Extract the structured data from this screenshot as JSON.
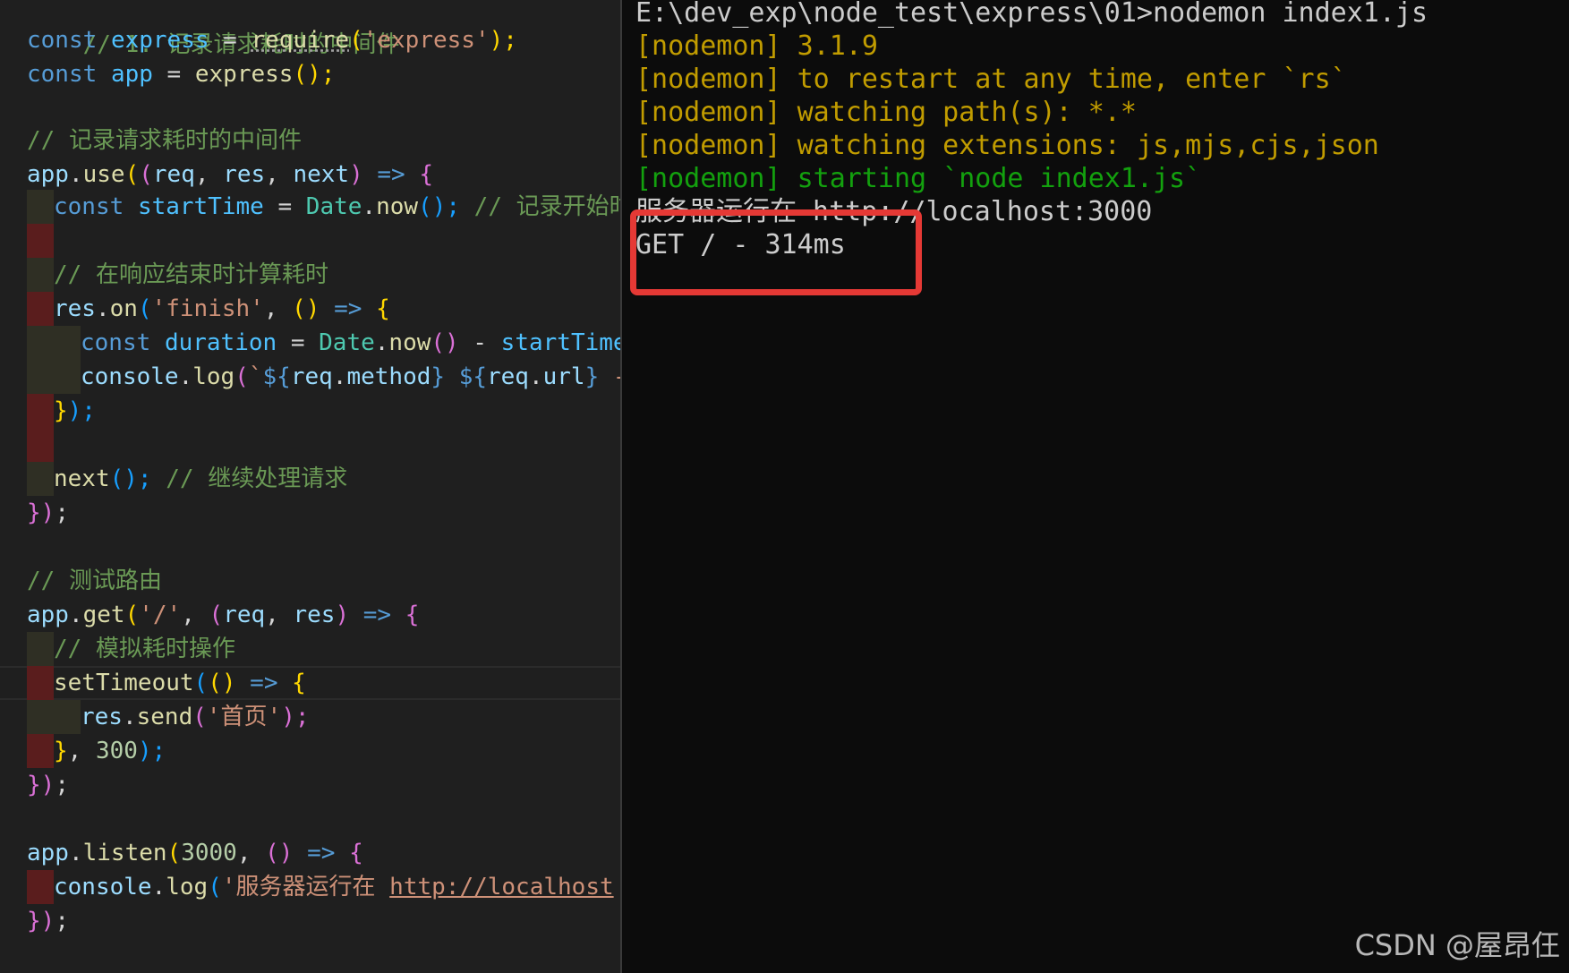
{
  "editor": {
    "lines": [
      [
        "// 1. 记录请求耗时的中间件"
      ],
      [
        "const",
        " ",
        "express",
        " = ",
        "require",
        "(",
        "'express'",
        ");"
      ],
      [
        "const",
        " ",
        "app",
        " = ",
        "express",
        "();"
      ],
      [
        ""
      ],
      [
        "// 记录请求耗时的中间件"
      ],
      [
        "app",
        ".",
        "use",
        "(",
        "(",
        "req",
        ", ",
        "res",
        ", ",
        "next",
        ")",
        " => ",
        "{"
      ],
      [
        "const",
        " ",
        "startTime",
        " = ",
        "Date",
        ".",
        "now",
        "();",
        " ",
        "// 记录开始时"
      ],
      [
        ""
      ],
      [
        "// 在响应结束时计算耗时"
      ],
      [
        "res",
        ".",
        "on",
        "(",
        "'finish'",
        ", ",
        "()",
        " => ",
        "{"
      ],
      [
        "const",
        " ",
        "duration",
        " = ",
        "Date",
        ".",
        "now",
        "()",
        " - ",
        "startTime"
      ],
      [
        "console",
        ".",
        "log",
        "(",
        "`",
        "${",
        "req",
        ".",
        "method",
        "}",
        " ",
        "${",
        "req",
        ".",
        "url",
        "}",
        " -"
      ],
      [
        "}",
        ");"
      ],
      [
        ""
      ],
      [
        "next",
        "();",
        " ",
        "// 继续处理请求"
      ],
      [
        "})",
        ";"
      ],
      [
        ""
      ],
      [
        "// 测试路由"
      ],
      [
        "app",
        ".",
        "get",
        "(",
        "'/'",
        ", ",
        "(",
        "req",
        ", ",
        "res",
        ")",
        " => ",
        "{"
      ],
      [
        "// 模拟耗时操作"
      ],
      [
        "setTimeout",
        "(",
        "()",
        " => ",
        "{"
      ],
      [
        "res",
        ".",
        "send",
        "(",
        "'首页'",
        ");"
      ],
      [
        "}",
        ", ",
        "300",
        ");"
      ],
      [
        "})",
        ";"
      ],
      [
        ""
      ],
      [
        "app",
        ".",
        "listen",
        "(",
        "3000",
        ", ",
        "()",
        " => ",
        "{"
      ],
      [
        "console",
        ".",
        "log",
        "(",
        "'服务器运行在 ",
        "http://localhost"
      ],
      [
        "})",
        ";"
      ]
    ]
  },
  "terminal": {
    "lines": [
      "E:\\dev_exp\\node_test\\express\\01>nodemon index1.js",
      "[nodemon] 3.1.9",
      "[nodemon] to restart at any time, enter `rs`",
      "[nodemon] watching path(s): *.*",
      "[nodemon] watching extensions: js,mjs,cjs,json",
      "[nodemon] starting `node index1.js`",
      "服务器运行在 http://localhost:3000",
      "GET / - 314ms"
    ]
  },
  "watermark": "CSDN @屋昂仼",
  "colors": {
    "annotation_box": "#e53935",
    "nodemon_yellow": "#c19c00",
    "nodemon_green": "#13a10e"
  }
}
